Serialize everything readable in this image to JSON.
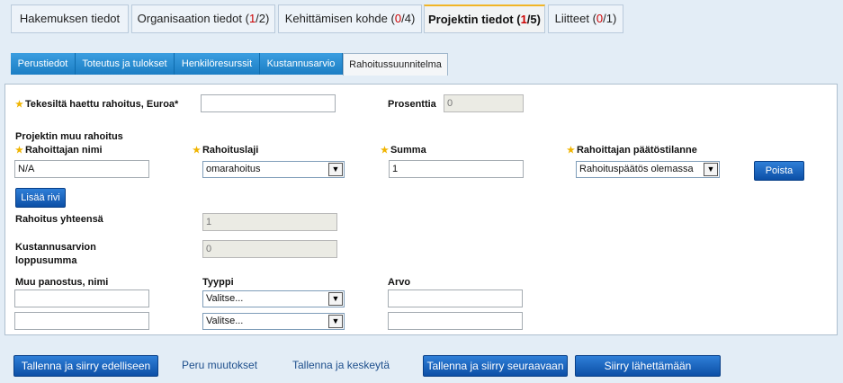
{
  "top_tabs": [
    {
      "label": "Hakemuksen tiedot",
      "count": "",
      "total": ""
    },
    {
      "label": "Organisaation tiedot",
      "count": "1",
      "total": "2"
    },
    {
      "label": "Kehittämisen kohde",
      "count": "0",
      "total": "4"
    },
    {
      "label": "Projektin tiedot",
      "count": "1",
      "total": "5"
    },
    {
      "label": "Liitteet",
      "count": "0",
      "total": "1"
    }
  ],
  "sub_tabs": [
    "Perustiedot",
    "Toteutus ja tulokset",
    "Henkilöresurssit",
    "Kustannusarvio",
    "Rahoitussuunnitelma"
  ],
  "form": {
    "tekes_label": "Tekesiltä haettu rahoitus, Euroa*",
    "tekes_value": "",
    "percent_label": "Prosenttia",
    "percent_value": "0",
    "other_funding_title": "Projektin muu rahoitus",
    "col_name": "Rahoittajan nimi",
    "col_type": "Rahoituslaji",
    "col_sum": "Summa",
    "col_status": "Rahoittajan päätöstilanne",
    "row_name": "N/A",
    "row_type": "omarahoitus",
    "row_sum": "1",
    "row_status": "Rahoituspäätös olemassa",
    "remove_button": "Poista",
    "add_row_button": "Lisää rivi",
    "total_label": "Rahoitus yhteensä",
    "total_value": "1",
    "budget_total_label_1": "Kustannusarvion",
    "budget_total_label_2": "loppusumma",
    "budget_total_value": "0",
    "other_label": "Muu panostus, nimi",
    "other_type_label": "Tyyppi",
    "other_value_label": "Arvo",
    "other_rows": [
      {
        "name": "",
        "type": "Valitse...",
        "value": ""
      },
      {
        "name": "",
        "type": "Valitse...",
        "value": ""
      }
    ]
  },
  "footer": {
    "prev": "Tallenna ja siirry edelliseen",
    "cancel": "Peru muutokset",
    "save_stop": "Tallenna ja keskeytä",
    "next": "Tallenna ja siirry seuraavaan",
    "send": "Siirry lähettämään"
  }
}
